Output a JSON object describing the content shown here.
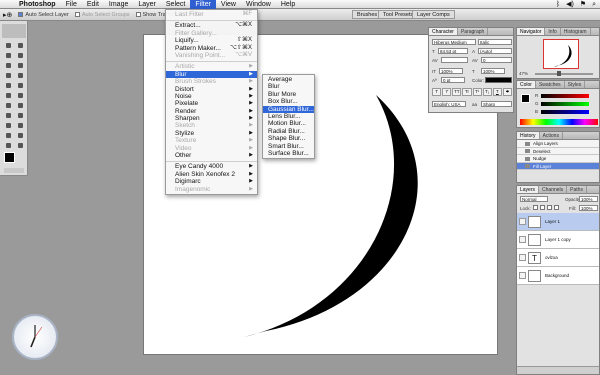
{
  "menubar": {
    "apple": "",
    "items": [
      "Photoshop",
      "File",
      "Edit",
      "Image",
      "Layer",
      "Select",
      "Filter",
      "View",
      "Window",
      "Help"
    ],
    "active_index": 6
  },
  "options": {
    "auto_select_layer": "Auto Select Layer",
    "auto_select_groups": "Auto Select Groups",
    "show_transform_controls": "Show Transform Controls",
    "tabs": [
      "Brushes",
      "Tool Presets",
      "Layer Comps"
    ]
  },
  "filter_menu": {
    "items": [
      {
        "label": "Last Filter",
        "shortcut": "⌘F",
        "disabled": true
      },
      {
        "sep": true
      },
      {
        "label": "Extract...",
        "shortcut": "⌥⌘X"
      },
      {
        "label": "Filter Gallery...",
        "disabled": true
      },
      {
        "label": "Liquify...",
        "shortcut": "⇧⌘X"
      },
      {
        "label": "Pattern Maker...",
        "shortcut": "⌥⇧⌘X"
      },
      {
        "label": "Vanishing Point...",
        "shortcut": "⌥⌘V",
        "disabled": true
      },
      {
        "sep": true
      },
      {
        "label": "Artistic",
        "submenu": true,
        "disabled": true
      },
      {
        "label": "Blur",
        "submenu": true,
        "highlight": true
      },
      {
        "label": "Brush Strokes",
        "submenu": true,
        "disabled": true
      },
      {
        "label": "Distort",
        "submenu": true
      },
      {
        "label": "Noise",
        "submenu": true
      },
      {
        "label": "Pixelate",
        "submenu": true
      },
      {
        "label": "Render",
        "submenu": true
      },
      {
        "label": "Sharpen",
        "submenu": true
      },
      {
        "label": "Sketch",
        "submenu": true,
        "disabled": true
      },
      {
        "label": "Stylize",
        "submenu": true
      },
      {
        "label": "Texture",
        "submenu": true,
        "disabled": true
      },
      {
        "label": "Video",
        "submenu": true,
        "disabled": true
      },
      {
        "label": "Other",
        "submenu": true
      },
      {
        "sep": true
      },
      {
        "label": "Eye Candy 4000",
        "submenu": true
      },
      {
        "label": "Alien Skin Xenofex 2",
        "submenu": true
      },
      {
        "label": "Digimarc",
        "submenu": true
      },
      {
        "label": "Imagenomic",
        "submenu": true,
        "disabled": true
      }
    ]
  },
  "blur_menu": {
    "items": [
      {
        "label": "Average"
      },
      {
        "label": "Blur"
      },
      {
        "label": "Blur More"
      },
      {
        "label": "Box Blur..."
      },
      {
        "label": "Gaussian Blur...",
        "highlight": true
      },
      {
        "label": "Lens Blur..."
      },
      {
        "label": "Motion Blur..."
      },
      {
        "label": "Radial Blur..."
      },
      {
        "label": "Shape Blur..."
      },
      {
        "label": "Smart Blur..."
      },
      {
        "label": "Surface Blur..."
      }
    ]
  },
  "character": {
    "tabs": [
      "Character",
      "Paragraph"
    ],
    "font": "Hiberus Medium",
    "style": "Italic",
    "size": "84.53 pt",
    "leading": "(Auto)",
    "tracking": "0",
    "vscale": "100%",
    "hscale": "100%",
    "baseline": "0 pt",
    "color_label": "Color:",
    "language": "English: USA",
    "aa": "Sharp"
  },
  "navigator": {
    "tabs": [
      "Navigator",
      "Info",
      "Histogram"
    ],
    "zoom": "47%"
  },
  "color": {
    "tabs": [
      "Color",
      "Swatches",
      "Styles"
    ],
    "labels": [
      "R",
      "G",
      "B"
    ]
  },
  "history": {
    "tabs": [
      "History",
      "Actions"
    ],
    "items": [
      "Align Layers",
      "Deselect",
      "Nudge",
      "Fill Layer"
    ],
    "selected": 3
  },
  "layers": {
    "tabs": [
      "Layers",
      "Channels",
      "Paths"
    ],
    "blend": "Normal",
    "opacity_label": "Opacity:",
    "opacity": "100%",
    "lock_label": "Lock:",
    "fill_label": "Fill:",
    "fill": "100%",
    "items": [
      {
        "name": "Layer 1",
        "selected": true
      },
      {
        "name": "Layer 1 copy"
      },
      {
        "name": "ovlzxa",
        "text": true
      },
      {
        "name": "Background"
      }
    ]
  },
  "colors": {
    "accent": "#3067d8",
    "crescent": "#000000"
  }
}
